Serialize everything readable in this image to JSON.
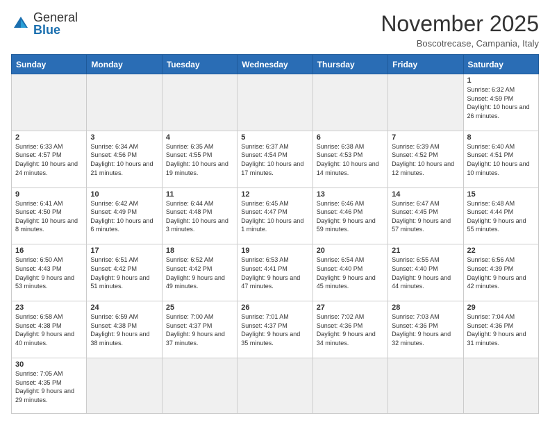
{
  "logo": {
    "text_general": "General",
    "text_blue": "Blue"
  },
  "title": "November 2025",
  "subtitle": "Boscotrecase, Campania, Italy",
  "weekdays": [
    "Sunday",
    "Monday",
    "Tuesday",
    "Wednesday",
    "Thursday",
    "Friday",
    "Saturday"
  ],
  "weeks": [
    [
      {
        "day": "",
        "empty": true
      },
      {
        "day": "",
        "empty": true
      },
      {
        "day": "",
        "empty": true
      },
      {
        "day": "",
        "empty": true
      },
      {
        "day": "",
        "empty": true
      },
      {
        "day": "",
        "empty": true
      },
      {
        "day": "1",
        "sunrise": "6:32 AM",
        "sunset": "4:59 PM",
        "daylight": "10 hours and 26 minutes."
      }
    ],
    [
      {
        "day": "2",
        "sunrise": "6:33 AM",
        "sunset": "4:57 PM",
        "daylight": "10 hours and 24 minutes."
      },
      {
        "day": "3",
        "sunrise": "6:34 AM",
        "sunset": "4:56 PM",
        "daylight": "10 hours and 21 minutes."
      },
      {
        "day": "4",
        "sunrise": "6:35 AM",
        "sunset": "4:55 PM",
        "daylight": "10 hours and 19 minutes."
      },
      {
        "day": "5",
        "sunrise": "6:37 AM",
        "sunset": "4:54 PM",
        "daylight": "10 hours and 17 minutes."
      },
      {
        "day": "6",
        "sunrise": "6:38 AM",
        "sunset": "4:53 PM",
        "daylight": "10 hours and 14 minutes."
      },
      {
        "day": "7",
        "sunrise": "6:39 AM",
        "sunset": "4:52 PM",
        "daylight": "10 hours and 12 minutes."
      },
      {
        "day": "8",
        "sunrise": "6:40 AM",
        "sunset": "4:51 PM",
        "daylight": "10 hours and 10 minutes."
      }
    ],
    [
      {
        "day": "9",
        "sunrise": "6:41 AM",
        "sunset": "4:50 PM",
        "daylight": "10 hours and 8 minutes."
      },
      {
        "day": "10",
        "sunrise": "6:42 AM",
        "sunset": "4:49 PM",
        "daylight": "10 hours and 6 minutes."
      },
      {
        "day": "11",
        "sunrise": "6:44 AM",
        "sunset": "4:48 PM",
        "daylight": "10 hours and 3 minutes."
      },
      {
        "day": "12",
        "sunrise": "6:45 AM",
        "sunset": "4:47 PM",
        "daylight": "10 hours and 1 minute."
      },
      {
        "day": "13",
        "sunrise": "6:46 AM",
        "sunset": "4:46 PM",
        "daylight": "9 hours and 59 minutes."
      },
      {
        "day": "14",
        "sunrise": "6:47 AM",
        "sunset": "4:45 PM",
        "daylight": "9 hours and 57 minutes."
      },
      {
        "day": "15",
        "sunrise": "6:48 AM",
        "sunset": "4:44 PM",
        "daylight": "9 hours and 55 minutes."
      }
    ],
    [
      {
        "day": "16",
        "sunrise": "6:50 AM",
        "sunset": "4:43 PM",
        "daylight": "9 hours and 53 minutes."
      },
      {
        "day": "17",
        "sunrise": "6:51 AM",
        "sunset": "4:42 PM",
        "daylight": "9 hours and 51 minutes."
      },
      {
        "day": "18",
        "sunrise": "6:52 AM",
        "sunset": "4:42 PM",
        "daylight": "9 hours and 49 minutes."
      },
      {
        "day": "19",
        "sunrise": "6:53 AM",
        "sunset": "4:41 PM",
        "daylight": "9 hours and 47 minutes."
      },
      {
        "day": "20",
        "sunrise": "6:54 AM",
        "sunset": "4:40 PM",
        "daylight": "9 hours and 45 minutes."
      },
      {
        "day": "21",
        "sunrise": "6:55 AM",
        "sunset": "4:40 PM",
        "daylight": "9 hours and 44 minutes."
      },
      {
        "day": "22",
        "sunrise": "6:56 AM",
        "sunset": "4:39 PM",
        "daylight": "9 hours and 42 minutes."
      }
    ],
    [
      {
        "day": "23",
        "sunrise": "6:58 AM",
        "sunset": "4:38 PM",
        "daylight": "9 hours and 40 minutes."
      },
      {
        "day": "24",
        "sunrise": "6:59 AM",
        "sunset": "4:38 PM",
        "daylight": "9 hours and 38 minutes."
      },
      {
        "day": "25",
        "sunrise": "7:00 AM",
        "sunset": "4:37 PM",
        "daylight": "9 hours and 37 minutes."
      },
      {
        "day": "26",
        "sunrise": "7:01 AM",
        "sunset": "4:37 PM",
        "daylight": "9 hours and 35 minutes."
      },
      {
        "day": "27",
        "sunrise": "7:02 AM",
        "sunset": "4:36 PM",
        "daylight": "9 hours and 34 minutes."
      },
      {
        "day": "28",
        "sunrise": "7:03 AM",
        "sunset": "4:36 PM",
        "daylight": "9 hours and 32 minutes."
      },
      {
        "day": "29",
        "sunrise": "7:04 AM",
        "sunset": "4:36 PM",
        "daylight": "9 hours and 31 minutes."
      }
    ],
    [
      {
        "day": "30",
        "sunrise": "7:05 AM",
        "sunset": "4:35 PM",
        "daylight": "9 hours and 29 minutes."
      },
      {
        "day": "",
        "empty": true
      },
      {
        "day": "",
        "empty": true
      },
      {
        "day": "",
        "empty": true
      },
      {
        "day": "",
        "empty": true
      },
      {
        "day": "",
        "empty": true
      },
      {
        "day": "",
        "empty": true
      }
    ]
  ],
  "labels": {
    "sunrise": "Sunrise:",
    "sunset": "Sunset:",
    "daylight": "Daylight:"
  }
}
